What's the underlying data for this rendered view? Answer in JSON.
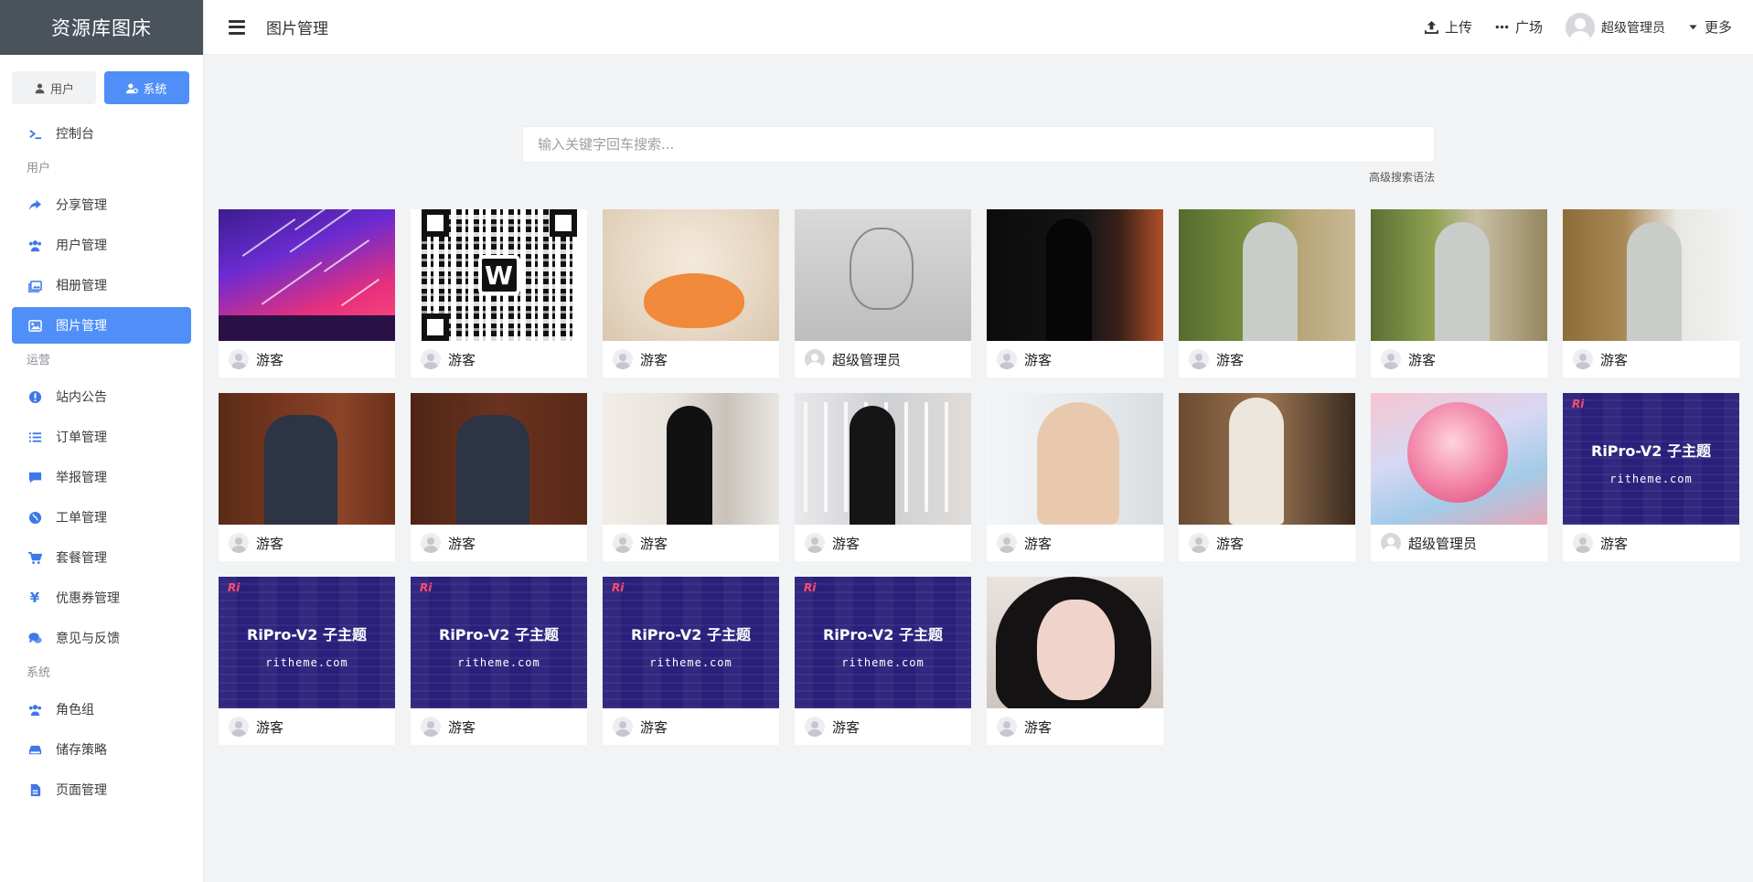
{
  "app": {
    "brand": "资源库图床"
  },
  "sidebar": {
    "mode_user": "用户",
    "mode_system": "系统",
    "dashboard": "控制台",
    "groups": {
      "user": "用户",
      "ops": "运营",
      "system": "系统"
    },
    "items": {
      "share": "分享管理",
      "users": "用户管理",
      "albums": "相册管理",
      "images": "图片管理",
      "notice": "站内公告",
      "orders": "订单管理",
      "reports": "举报管理",
      "tickets": "工单管理",
      "plans": "套餐管理",
      "coupons": "优惠券管理",
      "feedback": "意见与反馈",
      "roles": "角色组",
      "storage": "储存策略",
      "pages": "页面管理"
    }
  },
  "header": {
    "title": "图片管理",
    "upload": "上传",
    "square": "广场",
    "username": "超级管理员",
    "more": "更多"
  },
  "search": {
    "placeholder": "输入关键字回车搜索...",
    "advanced": "高级搜索语法"
  },
  "images": [
    {
      "style": "space",
      "uploader": "游客",
      "role": "guest"
    },
    {
      "style": "qr",
      "uploader": "游客",
      "role": "guest"
    },
    {
      "style": "duck",
      "uploader": "游客",
      "role": "guest"
    },
    {
      "style": "sketch",
      "uploader": "超级管理员",
      "role": "admin"
    },
    {
      "style": "dark",
      "uploader": "游客",
      "role": "guest"
    },
    {
      "style": "bamboo1",
      "uploader": "游客",
      "role": "guest"
    },
    {
      "style": "bamboo2",
      "uploader": "游客",
      "role": "guest"
    },
    {
      "style": "street",
      "uploader": "游客",
      "role": "guest"
    },
    {
      "style": "wood1",
      "uploader": "游客",
      "role": "guest"
    },
    {
      "style": "wood2",
      "uploader": "游客",
      "role": "guest"
    },
    {
      "style": "window",
      "uploader": "游客",
      "role": "guest"
    },
    {
      "style": "rail",
      "uploader": "游客",
      "role": "guest"
    },
    {
      "style": "bright",
      "uploader": "游客",
      "role": "guest"
    },
    {
      "style": "hotel",
      "uploader": "游客",
      "role": "guest"
    },
    {
      "style": "anime",
      "uploader": "超级管理员",
      "role": "admin"
    },
    {
      "style": "ripro",
      "uploader": "游客",
      "role": "guest"
    },
    {
      "style": "ripro",
      "uploader": "游客",
      "role": "guest"
    },
    {
      "style": "ripro",
      "uploader": "游客",
      "role": "guest"
    },
    {
      "style": "ripro",
      "uploader": "游客",
      "role": "guest"
    },
    {
      "style": "ripro",
      "uploader": "游客",
      "role": "guest"
    },
    {
      "style": "girl",
      "uploader": "游客",
      "role": "guest"
    }
  ],
  "ripro": {
    "title": "RiPro-V2 子主题",
    "site": "ritheme.com",
    "logo": "Ri"
  },
  "qr": {
    "letter": "W"
  },
  "colors": {
    "accent": "#4f8ff7",
    "brand_bg": "#4a525c",
    "icon": "#3e78e8"
  }
}
